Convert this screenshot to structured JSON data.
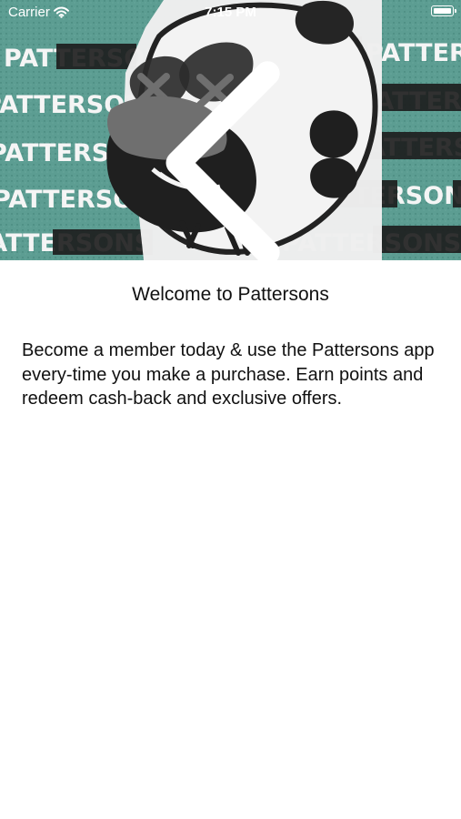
{
  "status_bar": {
    "carrier": "Carrier",
    "time": "7:15 PM",
    "wifi_icon": "wifi-icon",
    "battery_icon": "battery-icon"
  },
  "hero": {
    "brand_repeat_text": "PATTERSONS",
    "back_icon": "chevron-left-icon",
    "accent_color": "#4b8b80"
  },
  "main": {
    "title": "Welcome to Pattersons",
    "description": "Become a member today & use the Pattersons app every-time you make a purchase. Earn points and redeem cash-back and exclusive offers."
  }
}
